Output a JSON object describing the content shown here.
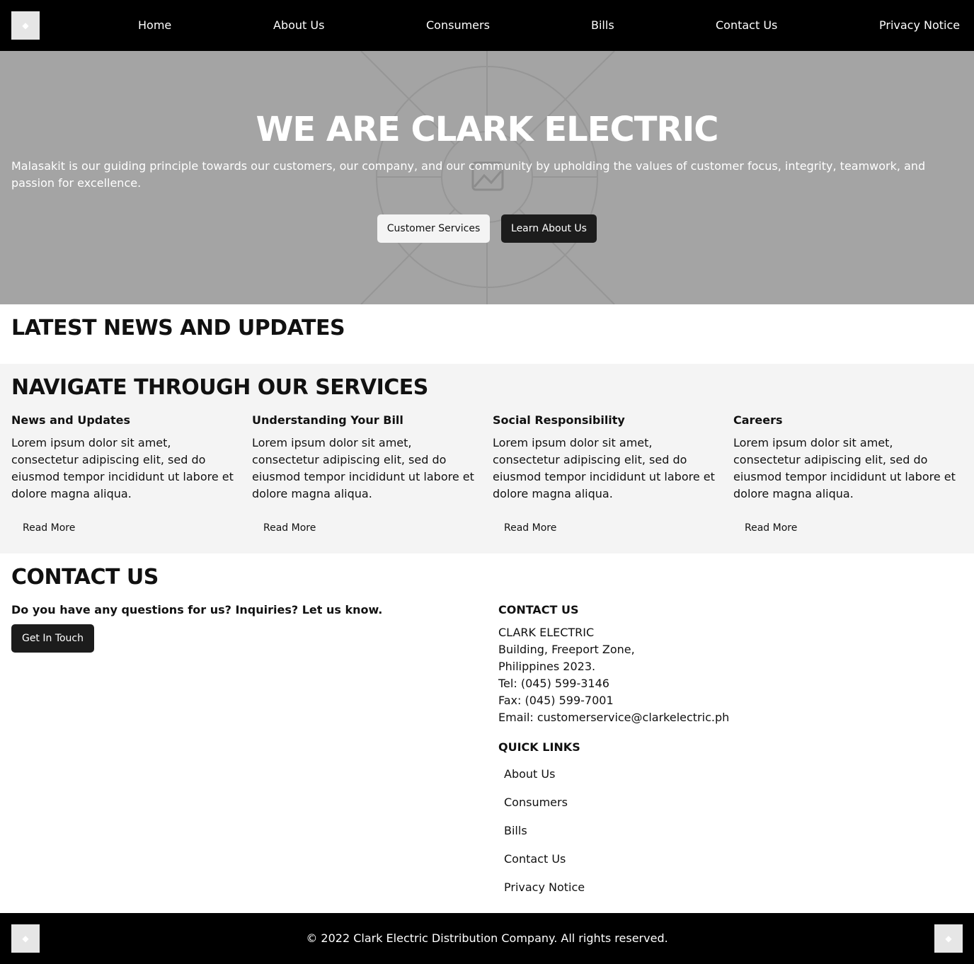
{
  "colors": {
    "nav_bg": "#000000",
    "hero_bg": "#a4a4a4",
    "services_bg": "#f4f4f4",
    "dark_button": "#1c1c1c",
    "light_button": "#f4f4f4"
  },
  "nav": {
    "logo_icon": "placeholder-logo-icon",
    "links": [
      "Home",
      "About Us",
      "Consumers",
      "Bills",
      "Contact Us",
      "Privacy Notice"
    ]
  },
  "hero": {
    "title": "WE ARE CLARK ELECTRIC",
    "subtitle": "Malasakit is our guiding principle towards our customers, our company, and our community by upholding the values of customer focus, integrity, teamwork, and passion for excellence.",
    "background_icon": "image-placeholder-icon",
    "primary_button": "Customer Services",
    "secondary_button": "Learn About Us"
  },
  "news": {
    "heading": "LATEST NEWS AND UPDATES"
  },
  "services": {
    "heading": "NAVIGATE THROUGH OUR SERVICES",
    "cards": [
      {
        "title": "News and Updates",
        "text": "Lorem ipsum dolor sit amet, consectetur adipiscing elit, sed do eiusmod tempor incididunt ut labore et dolore magna aliqua.",
        "link": "Read More"
      },
      {
        "title": "Understanding Your Bill",
        "text": "Lorem ipsum dolor sit amet, consectetur adipiscing elit, sed do eiusmod tempor incididunt ut labore et dolore magna aliqua.",
        "link": "Read More"
      },
      {
        "title": "Social Responsibility",
        "text": "Lorem ipsum dolor sit amet, consectetur adipiscing elit, sed do eiusmod tempor incididunt ut labore et dolore magna aliqua.",
        "link": "Read More"
      },
      {
        "title": "Careers",
        "text": "Lorem ipsum dolor sit amet, consectetur adipiscing elit, sed do eiusmod tempor incididunt ut labore et dolore magna aliqua.",
        "link": "Read More"
      }
    ]
  },
  "contact": {
    "heading": "CONTACT US",
    "question": "Do you have any questions for us? Inquiries? Let us know.",
    "button": "Get In Touch",
    "info_heading": "CONTACT US",
    "info_lines": [
      "CLARK ELECTRIC",
      "Building, Freeport Zone,",
      "Philippines 2023.",
      "Tel: (045) 599-3146",
      "Fax: (045) 599-7001",
      "Email: customerservice@clarkelectric.ph"
    ],
    "quick_links_heading": "QUICK LINKS",
    "quick_links": [
      "About Us",
      "Consumers",
      "Bills",
      "Contact Us",
      "Privacy Notice"
    ]
  },
  "footer": {
    "copyright": "© 2022 Clark Electric Distribution Company. All rights reserved.",
    "left_icon": "placeholder-icon",
    "right_icon": "placeholder-icon"
  }
}
